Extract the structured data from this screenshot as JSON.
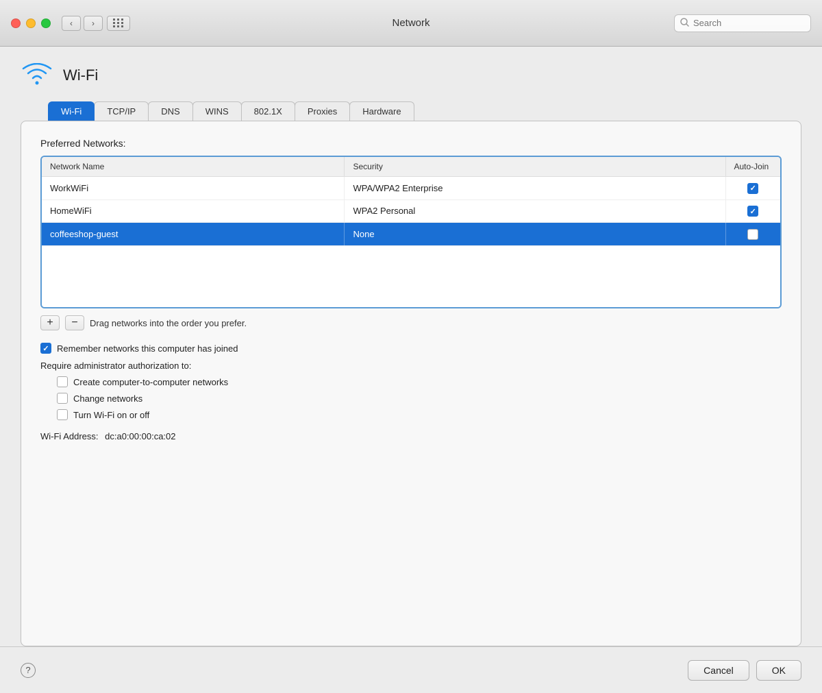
{
  "titlebar": {
    "title": "Network",
    "search_placeholder": "Search"
  },
  "wifi": {
    "title": "Wi-Fi"
  },
  "tabs": [
    {
      "label": "Wi-Fi",
      "active": true
    },
    {
      "label": "TCP/IP",
      "active": false
    },
    {
      "label": "DNS",
      "active": false
    },
    {
      "label": "WINS",
      "active": false
    },
    {
      "label": "802.1X",
      "active": false
    },
    {
      "label": "Proxies",
      "active": false
    },
    {
      "label": "Hardware",
      "active": false
    }
  ],
  "preferred_networks": {
    "label": "Preferred Networks:",
    "columns": [
      "Network Name",
      "Security",
      "Auto-Join"
    ],
    "rows": [
      {
        "name": "WorkWiFi",
        "security": "WPA/WPA2 Enterprise",
        "auto_join": true,
        "selected": false
      },
      {
        "name": "HomeWiFi",
        "security": "WPA2 Personal",
        "auto_join": true,
        "selected": false
      },
      {
        "name": "coffeeshop-guest",
        "security": "None",
        "auto_join": false,
        "selected": true
      }
    ]
  },
  "buttons": {
    "add": "+",
    "remove": "−",
    "drag_hint": "Drag networks into the order you prefer."
  },
  "options": {
    "remember_networks": {
      "label": "Remember networks this computer has joined",
      "checked": true
    },
    "require_admin_label": "Require administrator authorization to:",
    "admin_options": [
      {
        "label": "Create computer-to-computer networks",
        "checked": false
      },
      {
        "label": "Change networks",
        "checked": false
      },
      {
        "label": "Turn Wi-Fi on or off",
        "checked": false
      }
    ]
  },
  "wifi_address": {
    "label": "Wi-Fi Address:",
    "value": "dc:a0:00:00:ca:02"
  },
  "bottom": {
    "help": "?",
    "cancel": "Cancel",
    "ok": "OK"
  }
}
